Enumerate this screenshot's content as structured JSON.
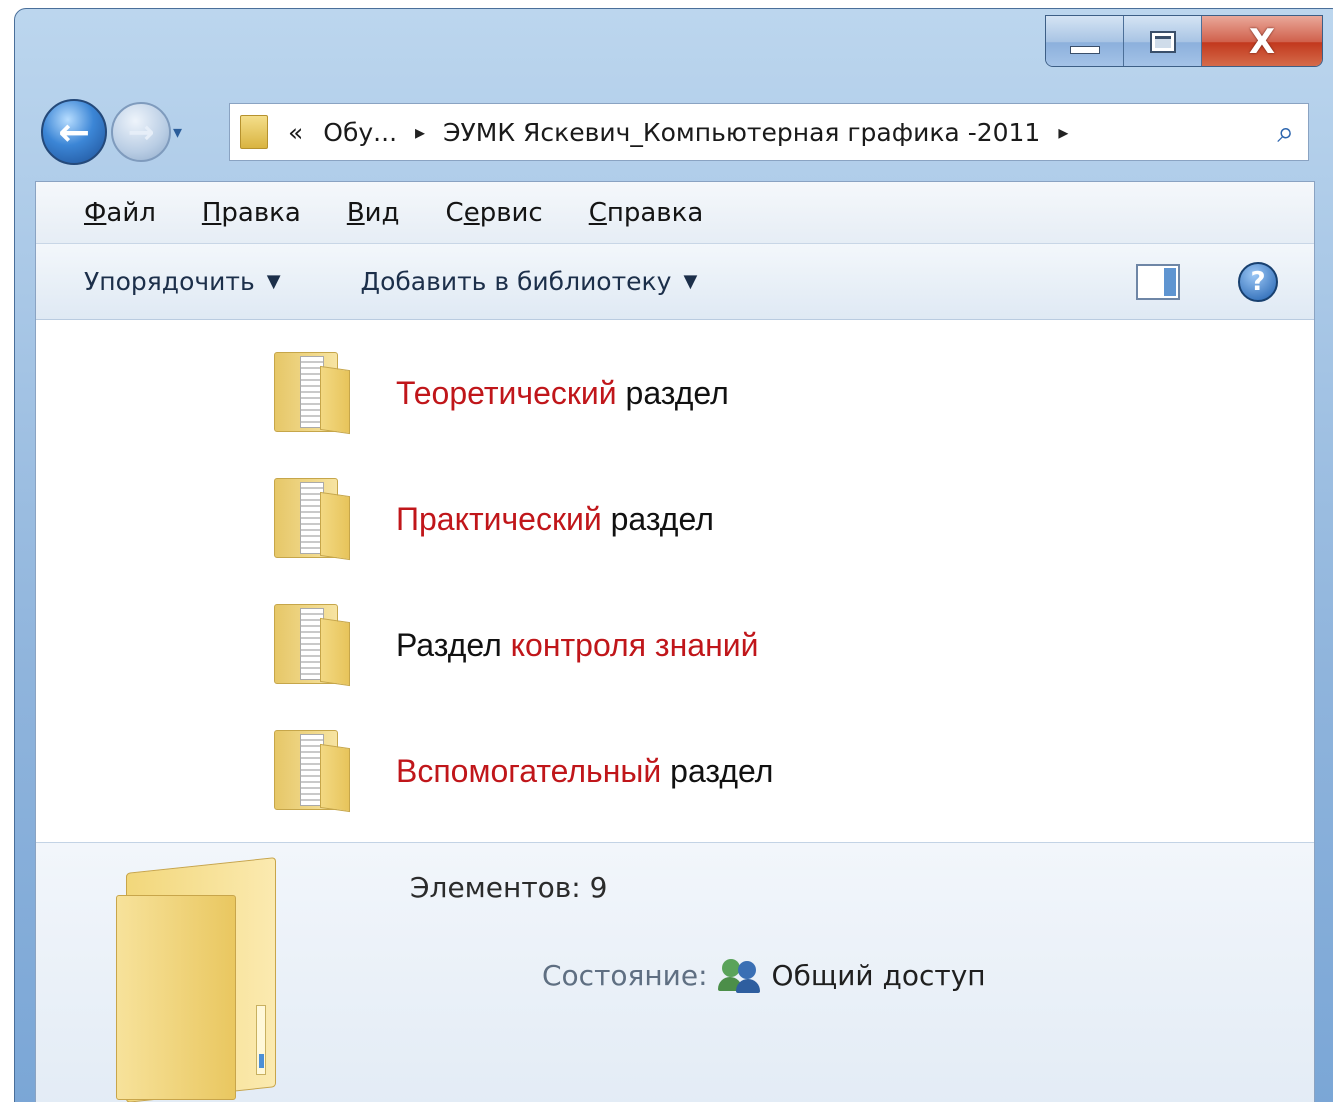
{
  "window": {
    "caption_buttons": {
      "minimize_icon": "minimize-icon",
      "maximize_icon": "maximize-icon",
      "close_glyph": "X"
    }
  },
  "navigation": {
    "back_glyph": "←",
    "forward_glyph": "→",
    "dropdown_glyph": "▾"
  },
  "address": {
    "overflow": "«",
    "crumb1": "Обу...",
    "sep1": "▸",
    "crumb2": "ЭУМК Яскевич_Компьютерная графика -2011",
    "sep2": "▸",
    "search_glyph": "⌕"
  },
  "menu": {
    "items": [
      {
        "accel": "Ф",
        "rest": "айл"
      },
      {
        "accel": "П",
        "rest": "равка"
      },
      {
        "accel": "В",
        "rest": "ид"
      },
      {
        "pre": "С",
        "accel": "е",
        "rest": "рвис"
      },
      {
        "accel": "С",
        "rest": "правка"
      }
    ]
  },
  "toolbar": {
    "organize": "Упорядочить",
    "add_to_library": "Добавить в библиотеку",
    "arrow": "▼",
    "help_glyph": "?"
  },
  "files": [
    {
      "red": "Теоретический",
      "black": "раздел"
    },
    {
      "red": "Практический",
      "black": "раздел"
    },
    {
      "black": "Раздел",
      "red": "контроля знаний"
    },
    {
      "red": "Вспомогательный",
      "black": "раздел"
    }
  ],
  "details": {
    "count": "Элементов: 9",
    "state_label": "Состояние:",
    "state_value": "Общий доступ"
  },
  "colors": {
    "accent_red": "#c0161a",
    "frame_blue": "#8fb4dc"
  }
}
